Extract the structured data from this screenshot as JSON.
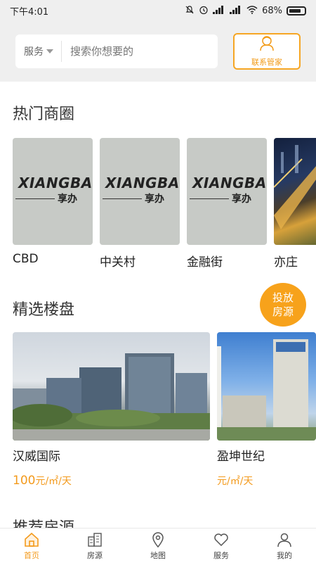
{
  "status_bar": {
    "time": "下午4:01",
    "battery": "68%"
  },
  "header": {
    "service_select": "服务",
    "search_placeholder": "搜索你想要的",
    "contact_label": "联系管家"
  },
  "hot_districts": {
    "title": "热门商圈",
    "logo_text": "XIANGBAN",
    "logo_sub": "享办",
    "items": [
      {
        "name": "CBD"
      },
      {
        "name": "中关村"
      },
      {
        "name": "金融街"
      },
      {
        "name": "亦庄"
      }
    ]
  },
  "featured": {
    "title": "精选楼盘",
    "publish_label_1": "投放",
    "publish_label_2": "房源",
    "items": [
      {
        "name": "汉威国际",
        "price": "100",
        "unit": "元/㎡/天"
      },
      {
        "name": "盈坤世纪",
        "price": "",
        "unit": "元/㎡/天"
      }
    ]
  },
  "recommend": {
    "title": "推荐房源"
  },
  "bottom_nav": {
    "items": [
      {
        "label": "首页",
        "icon": "home-icon",
        "active": true
      },
      {
        "label": "房源",
        "icon": "building-icon",
        "active": false
      },
      {
        "label": "地图",
        "icon": "map-pin-icon",
        "active": false
      },
      {
        "label": "服务",
        "icon": "heart-icon",
        "active": false
      },
      {
        "label": "我的",
        "icon": "user-icon",
        "active": false
      }
    ]
  },
  "colors": {
    "accent": "#f39a1c",
    "header_bg": "#efefef"
  }
}
